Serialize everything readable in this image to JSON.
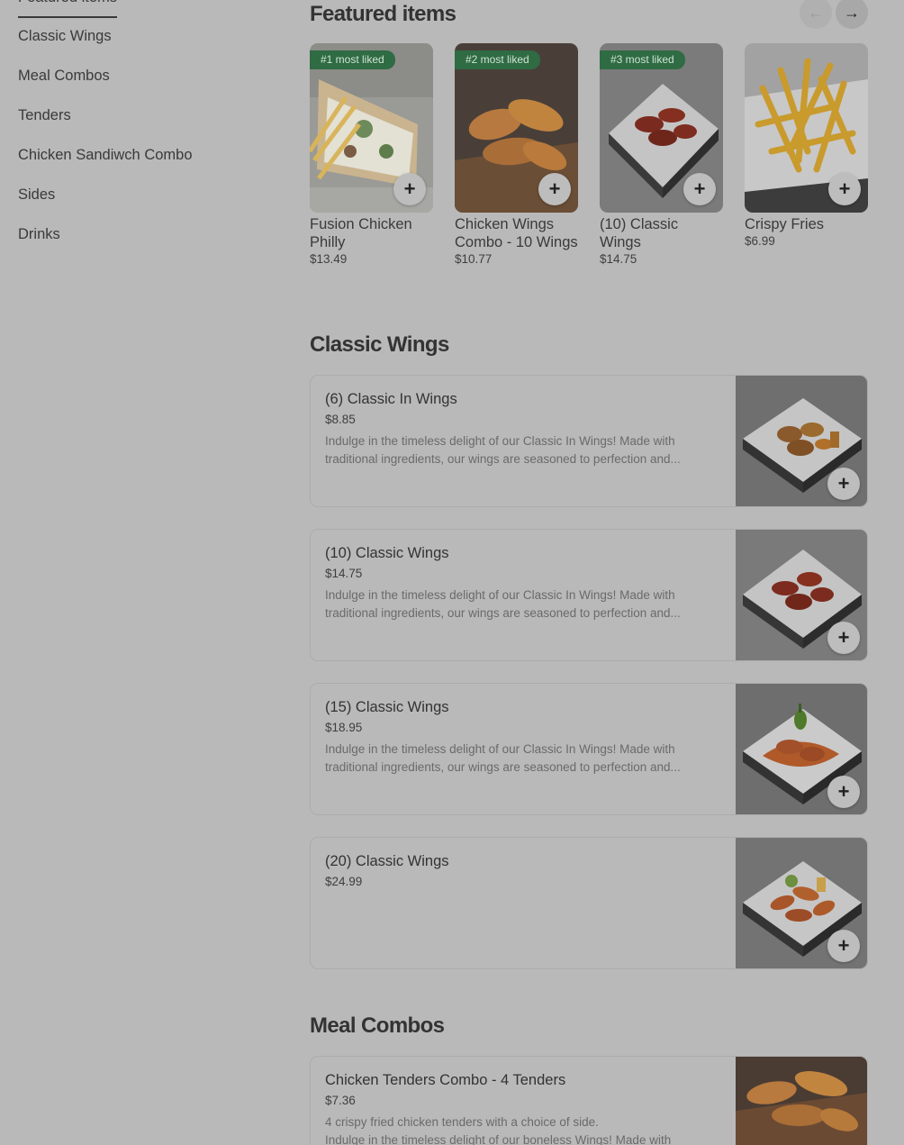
{
  "sidebar": {
    "active": "Featured items",
    "items": [
      "Classic Wings",
      "Meal Combos",
      "Tenders",
      "Chicken Sandiwch Combo",
      "Sides",
      "Drinks"
    ]
  },
  "featured": {
    "title": "Featured items",
    "prev_icon": "arrow-left-icon",
    "next_icon": "arrow-right-icon",
    "items": [
      {
        "badge": "#1 most liked",
        "name": "Fusion Chicken Philly",
        "price": "$13.49"
      },
      {
        "badge": "#2 most liked",
        "name": "Chicken Wings Combo - 10 Wings",
        "price": "$10.77"
      },
      {
        "badge": "#3 most liked",
        "name": "(10) Classic Wings",
        "price": "$14.75"
      },
      {
        "badge": "",
        "name": "Crispy Fries",
        "price": "$6.99"
      }
    ]
  },
  "classic_wings": {
    "title": "Classic Wings",
    "items": [
      {
        "name": "(6) Classic In Wings",
        "price": "$8.85",
        "desc": "Indulge in the timeless delight of our Classic In Wings! Made with traditional ingredients, our wings are seasoned to perfection and..."
      },
      {
        "name": "(10) Classic Wings",
        "price": "$14.75",
        "desc": "Indulge in the timeless delight of our Classic In Wings! Made with traditional ingredients, our wings are seasoned to perfection and..."
      },
      {
        "name": "(15) Classic Wings",
        "price": "$18.95",
        "desc": "Indulge in the timeless delight of our Classic In Wings! Made with traditional ingredients, our wings are seasoned to perfection and..."
      },
      {
        "name": "(20) Classic Wings",
        "price": "$24.99",
        "desc": ""
      }
    ]
  },
  "meal_combos": {
    "title": "Meal Combos",
    "items": [
      {
        "name": "Chicken Tenders Combo - 4 Tenders",
        "price": "$7.36",
        "desc": "4 crispy fried chicken tenders with a choice of side.\nIndulge in the timeless delight of our boneless Wings! Made with"
      }
    ]
  },
  "plus_icon": "plus-icon",
  "colors": {
    "overlay_bg": "#b9b9b9",
    "badge_bg": "#2f6b43"
  }
}
